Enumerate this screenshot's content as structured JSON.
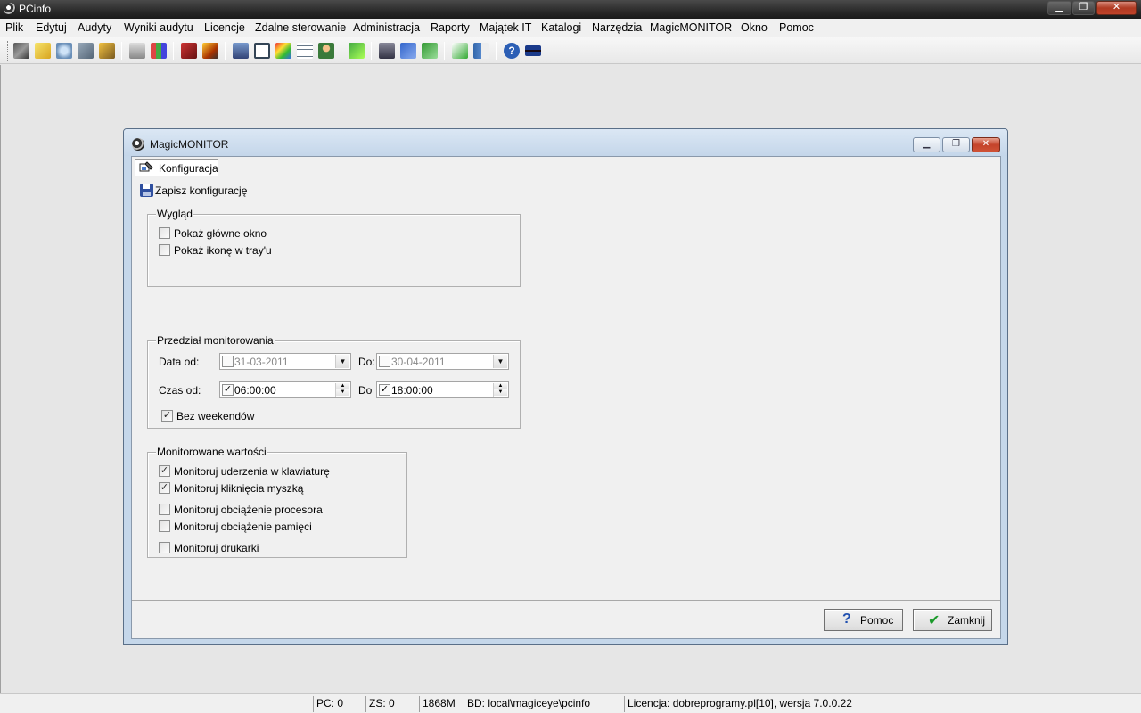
{
  "app": {
    "title": "PCinfo"
  },
  "menu": [
    "Plik",
    "Edytuj",
    "Audyty",
    "Wyniki audytu",
    "Licencje",
    "Zdalne sterowanie",
    "Administracja",
    "Raporty",
    "Majątek IT",
    "Katalogi",
    "Narzędzia",
    "MagicMONITOR",
    "Okno",
    "Pomoc"
  ],
  "toolbar_icons": [
    "wizard-icon",
    "up-folder-icon",
    "network-icon",
    "tools-icon",
    "key-icon",
    "printer-icon",
    "chart-icon",
    "book-icon",
    "package-icon",
    "building-icon",
    "window-icon",
    "color-palette-icon",
    "document-list-icon",
    "user-icon",
    "money-icon",
    "computer-network-icon",
    "monitors-icon",
    "monitor-green-icon",
    "checklist-icon",
    "library-icon",
    "help-icon",
    "uk-flag-icon"
  ],
  "child_window": {
    "title": "MagicMONITOR",
    "tab": "Konfiguracja",
    "save_label": "Zapisz konfigurację",
    "wyglad": {
      "legend": "Wygląd",
      "show_main_window": {
        "label": "Pokaż główne okno",
        "checked": false
      },
      "show_tray_icon": {
        "label": "Pokaż ikonę w tray'u",
        "checked": false
      }
    },
    "przedzial": {
      "legend": "Przedział monitorowania",
      "date_from_label": "Data od:",
      "date_from": "31-03-2011",
      "date_from_enabled": false,
      "date_to_label": "Do:",
      "date_to": "30-04-2011",
      "date_to_enabled": false,
      "time_from_label": "Czas od:",
      "time_from": "06:00:00",
      "time_from_enabled": true,
      "time_to_label": "Do",
      "time_to": "18:00:00",
      "time_to_enabled": true,
      "no_weekends": {
        "label": "Bez weekendów",
        "checked": true
      }
    },
    "wartosci": {
      "legend": "Monitorowane wartości",
      "items": [
        {
          "label": "Monitoruj uderzenia w klawiaturę",
          "checked": true
        },
        {
          "label": "Monitoruj kliknięcia myszką",
          "checked": true
        },
        {
          "label": "Monitoruj obciążenie procesora",
          "checked": false
        },
        {
          "label": "Monitoruj obciążenie pamięci",
          "checked": false
        },
        {
          "label": "Monitoruj drukarki",
          "checked": false
        }
      ]
    },
    "buttons": {
      "help": "Pomoc",
      "close": "Zamknij"
    }
  },
  "statusbar": {
    "pc": "PC: 0",
    "zs": "ZS: 0",
    "memory": "1868M",
    "db": "BD: local\\magiceye\\pcinfo",
    "license": "Licencja: dobreprogramy.pl[10], wersja 7.0.0.22"
  },
  "colors": {
    "title_bar": "#2a2a2a",
    "window_frame": "#c5d7ea",
    "close_red": "#c4432a",
    "face": "#f0f0f0"
  }
}
